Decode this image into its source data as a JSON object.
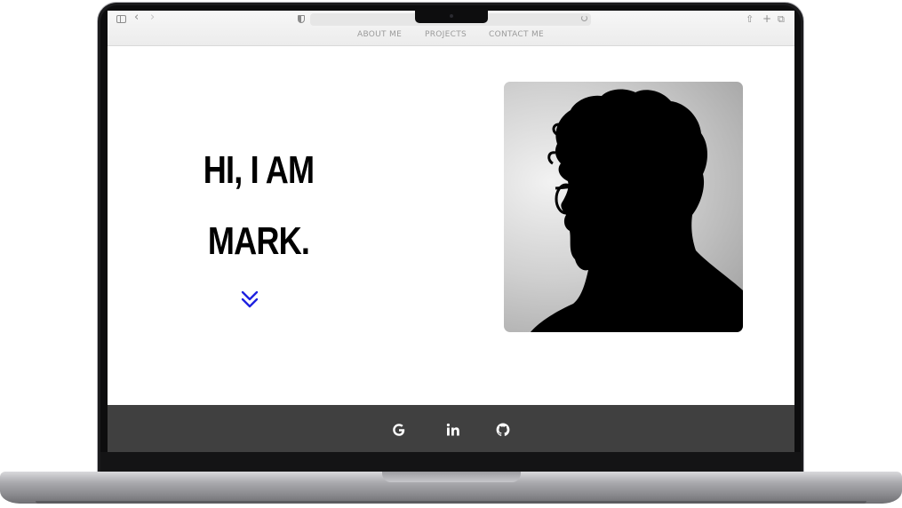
{
  "browser": {
    "back_glyph": "‹",
    "forward_glyph": "›",
    "share_glyph": "⇧",
    "new_tab_glyph": "+",
    "tabs_glyph": "⧉"
  },
  "nav": {
    "items": [
      {
        "label": "ABOUT ME"
      },
      {
        "label": "PROJECTS"
      },
      {
        "label": "CONTACT ME"
      }
    ]
  },
  "hero": {
    "line1": "HI, I AM",
    "line2": "MARK.",
    "accent_color": "#1f22e0",
    "portrait_icon": "silhouette-portrait"
  },
  "footer": {
    "background": "#404040",
    "links": [
      {
        "icon": "google-icon"
      },
      {
        "icon": "linkedin-icon"
      },
      {
        "icon": "github-icon"
      }
    ]
  }
}
